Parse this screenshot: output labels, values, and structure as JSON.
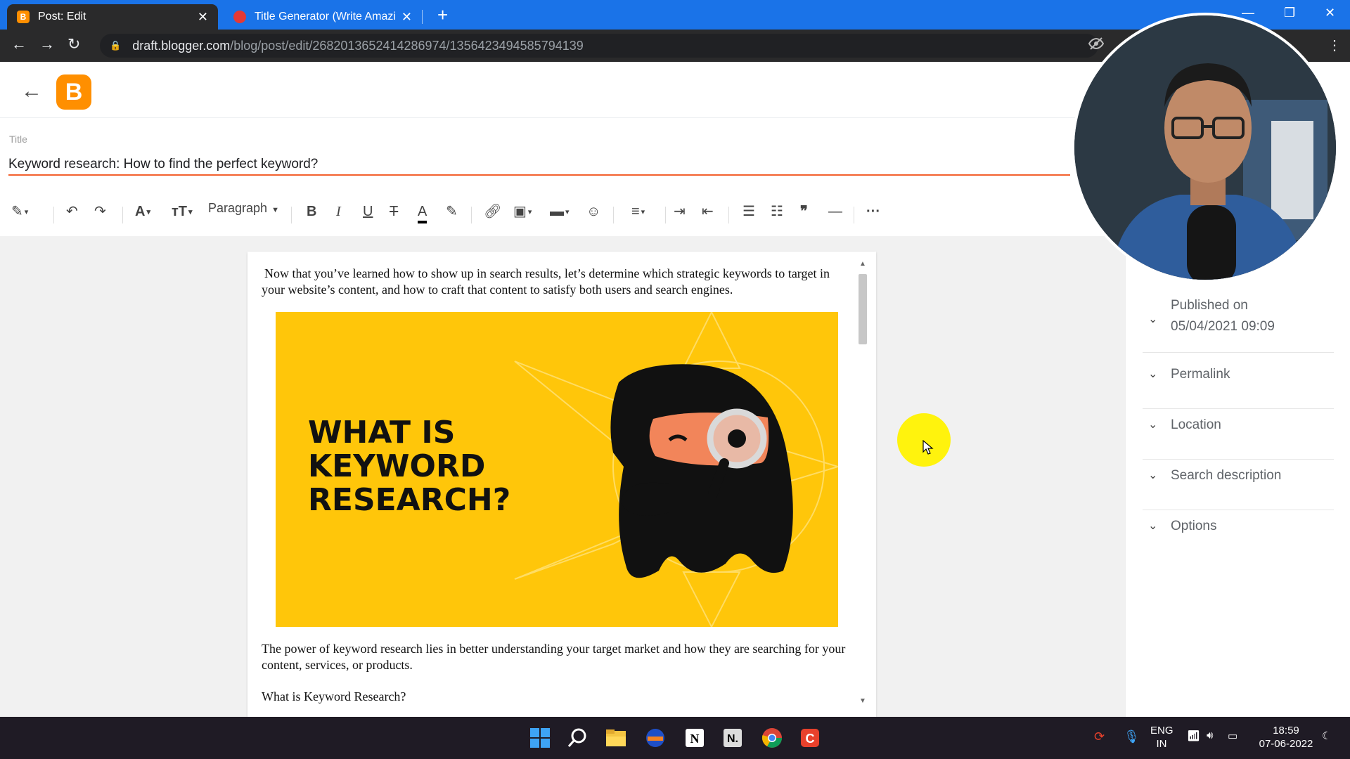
{
  "browser": {
    "tabs": [
      {
        "title": "Post: Edit",
        "active": true,
        "favicon": "blogger-icon"
      },
      {
        "title": "Title Generator (Write Amazing H",
        "active": false,
        "favicon": "seo-icon"
      }
    ],
    "url_host": "draft.blogger.com",
    "url_path": "/blog/post/edit/2682013652414286974/1356423494585794139"
  },
  "editor": {
    "title_label": "Title",
    "title_value": "Keyword research: How to find the perfect keyword?",
    "paragraph_style": "Paragraph",
    "content": {
      "intro": "Now that you’ve learned how to show up in search results, let’s determine which strategic keywords to target in your website’s content, and how to craft that content to satisfy both users and search engines.",
      "image_headline": "WHAT IS\nKEYWORD\nRESEARCH?",
      "para2": "The power of keyword research lies in better understanding your target market and how they are searching for your content, services, or products.",
      "para3": "What is Keyword Research?"
    }
  },
  "sidebar": {
    "items": [
      {
        "label": "Published on",
        "value": "05/04/2021 09:09"
      },
      {
        "label": "Permalink"
      },
      {
        "label": "Location"
      },
      {
        "label": "Search description"
      },
      {
        "label": "Options"
      }
    ]
  },
  "taskbar": {
    "lang_top": "ENG",
    "lang_bottom": "IN",
    "time": "18:59",
    "date": "07-06-2022"
  },
  "colors": {
    "chrome_blue": "#1a73e8",
    "blogger_orange": "#ff8f00",
    "title_underline": "#f3612e",
    "image_yellow": "#ffc60a"
  }
}
